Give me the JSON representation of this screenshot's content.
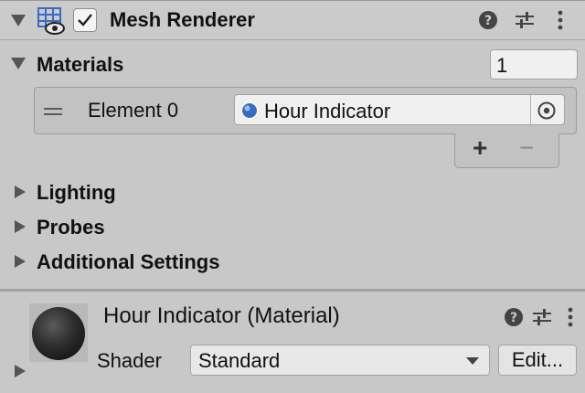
{
  "component": {
    "title": "Mesh Renderer",
    "enabled": true
  },
  "materials": {
    "label": "Materials",
    "count": "1",
    "elements": [
      {
        "label": "Element 0",
        "value": "Hour Indicator"
      }
    ],
    "add_label": "+",
    "remove_label": "−"
  },
  "sections": [
    {
      "label": "Lighting"
    },
    {
      "label": "Probes"
    },
    {
      "label": "Additional Settings"
    }
  ],
  "material_panel": {
    "title": "Hour Indicator (Material)",
    "shader_label": "Shader",
    "shader_value": "Standard",
    "edit_label": "Edit..."
  },
  "colors": {
    "accent_blue": "#3a6bc4",
    "panel_bg": "#c8c8c8"
  },
  "icons": [
    "mesh-renderer-icon",
    "checkmark-icon",
    "help-icon",
    "preset-icon",
    "kebab-menu-icon",
    "object-picker-icon",
    "drag-handle-icon",
    "material-dot-icon",
    "dropdown-arrow-icon"
  ]
}
